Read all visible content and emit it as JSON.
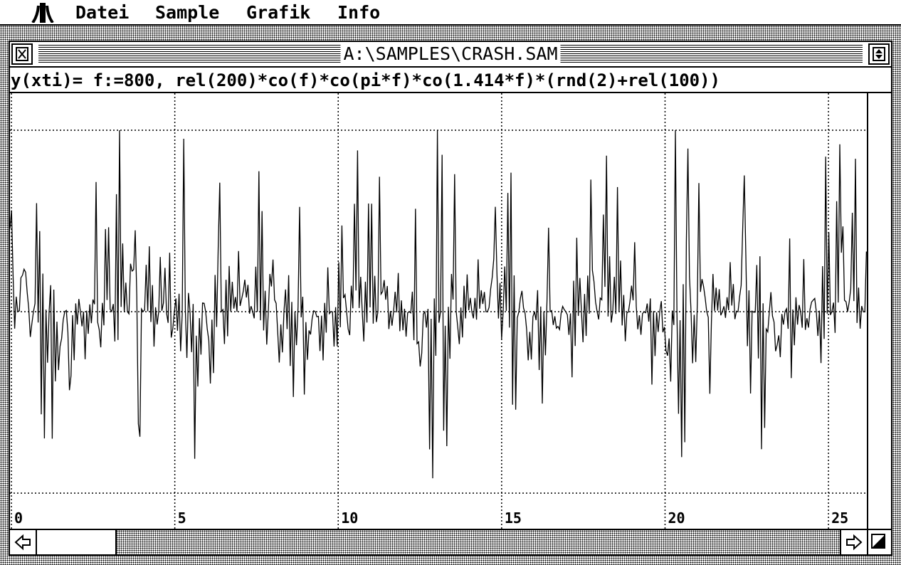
{
  "menubar": {
    "logo_icon": "atari-fuji-icon",
    "items": [
      "Datei",
      "Sample",
      "Grafik",
      "Info"
    ]
  },
  "window": {
    "title": "A:\\SAMPLES\\CRASH.SAM",
    "formula": "y(xti)= f:=800, rel(200)*co(f)*co(pi*f)*co(1.414*f)*(rnd(2)+rel(100))"
  },
  "chart_data": {
    "type": "line",
    "title": "",
    "xlabel": "",
    "ylabel": "",
    "x_ticks": [
      "0",
      "5",
      "10",
      "15",
      "20",
      "25"
    ],
    "xlim": [
      0,
      26
    ],
    "ylim": [
      -1,
      1
    ],
    "grid": true,
    "description_of_series": "dense noisy crash waveform oscillating around zero, bursts near each major tick"
  },
  "colors": {
    "foreground": "#000000",
    "background": "#ffffff"
  }
}
